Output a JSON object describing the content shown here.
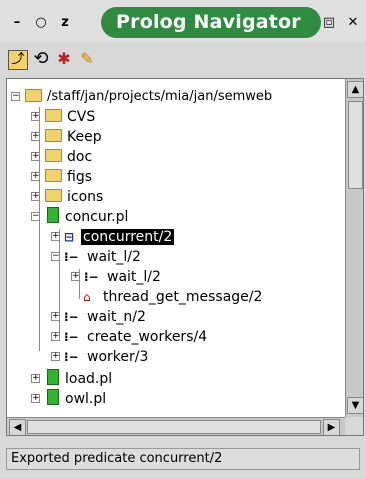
{
  "window": {
    "title": "Prolog Navigator",
    "controls": [
      "minimize",
      "restore",
      "shade",
      "maximize",
      "close"
    ]
  },
  "toolbar": {
    "buttons": [
      {
        "icon": "folder-up-icon"
      },
      {
        "icon": "refresh-icon"
      },
      {
        "icon": "bug-icon"
      },
      {
        "icon": "edit-pencil-icon"
      }
    ]
  },
  "tree": {
    "root": "/staff/jan/projects/mia/jan/semweb",
    "items": [
      {
        "label": "CVS",
        "type": "folder",
        "level": 1
      },
      {
        "label": "Keep",
        "type": "folder",
        "level": 1
      },
      {
        "label": "doc",
        "type": "folder",
        "level": 1
      },
      {
        "label": "figs",
        "type": "folder",
        "level": 1
      },
      {
        "label": "icons",
        "type": "folder",
        "level": 1
      },
      {
        "label": "concur.pl",
        "type": "file",
        "level": 1
      },
      {
        "label": "concurrent/2",
        "type": "exported-predicate",
        "level": 2,
        "selected": true
      },
      {
        "label": "wait_l/2",
        "type": "predicate",
        "level": 2
      },
      {
        "label": "wait_l/2",
        "type": "predicate",
        "level": 3
      },
      {
        "label": "thread_get_message/2",
        "type": "builtin",
        "level": 3
      },
      {
        "label": "wait_n/2",
        "type": "predicate",
        "level": 2
      },
      {
        "label": "create_workers/4",
        "type": "predicate",
        "level": 2
      },
      {
        "label": "worker/3",
        "type": "predicate",
        "level": 2
      },
      {
        "label": "load.pl",
        "type": "file",
        "level": 1
      },
      {
        "label": "owl.pl",
        "type": "file",
        "level": 1
      }
    ]
  },
  "status": {
    "text": "Exported predicate concurrent/2"
  }
}
